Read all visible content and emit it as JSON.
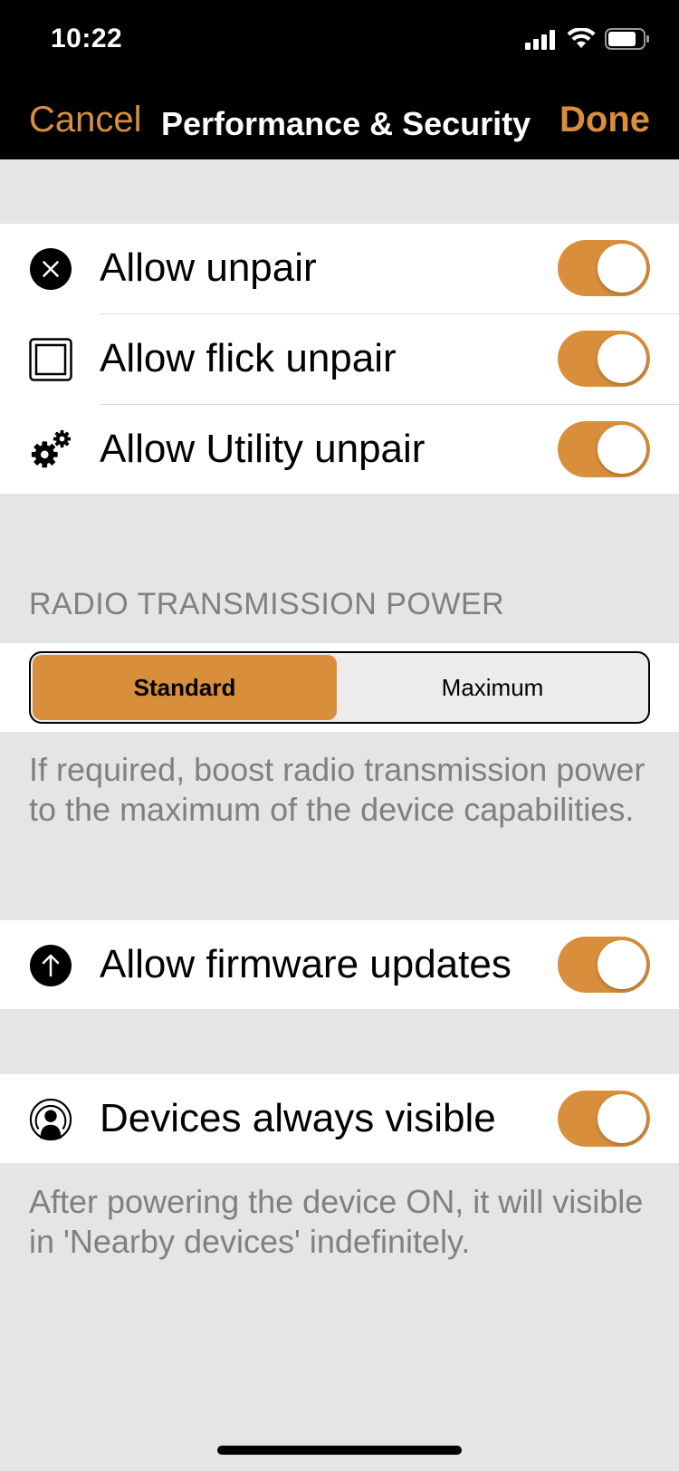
{
  "status_bar": {
    "time": "10:22",
    "signal_icon": "cellular-signal-icon",
    "wifi_icon": "wifi-icon",
    "battery_icon": "battery-icon"
  },
  "nav": {
    "cancel_label": "Cancel",
    "title": "Performance & Security",
    "done_label": "Done"
  },
  "unpair_group": {
    "items": [
      {
        "label": "Allow unpair",
        "icon": "close-circle-icon",
        "enabled": true
      },
      {
        "label": "Allow flick unpair",
        "icon": "square-icon",
        "enabled": true
      },
      {
        "label": "Allow Utility unpair",
        "icon": "gears-icon",
        "enabled": true
      }
    ]
  },
  "radio_power": {
    "header": "RADIO TRANSMISSION POWER",
    "options": [
      "Standard",
      "Maximum"
    ],
    "selected": "Standard",
    "footnote": "If required, boost radio transmission power to the maximum of the device capabilities."
  },
  "firmware": {
    "label": "Allow firmware updates",
    "icon": "arrow-up-circle-icon",
    "enabled": true
  },
  "visibility": {
    "label": "Devices always visible",
    "icon": "broadcast-person-icon",
    "enabled": true,
    "footnote": "After powering the device ON, it will visible in 'Nearby devices' indefinitely."
  },
  "colors": {
    "accent": "#d98e3c",
    "background": "#e5e5e5",
    "bar": "#000000"
  }
}
